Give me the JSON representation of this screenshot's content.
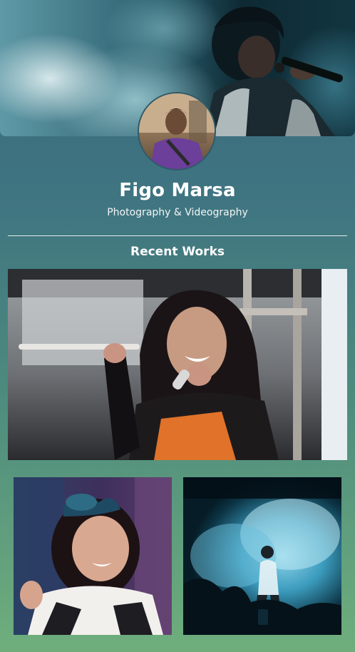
{
  "profile": {
    "name": "Figo Marsa",
    "tagline": "Photography & Videography"
  },
  "sections": {
    "recent_works_title": "Recent Works"
  },
  "images": {
    "cover": "concert-singer-smoke-cover-photo",
    "avatar": "profile-portrait-photo",
    "works": [
      "stage-performer-singing-photo",
      "performer-with-hair-bow-photo",
      "stage-singer-blue-smoke-photo"
    ]
  },
  "colors": {
    "background_top": "#3b6a7e",
    "background_bottom": "#6fae7c",
    "text": "#ffffff"
  }
}
